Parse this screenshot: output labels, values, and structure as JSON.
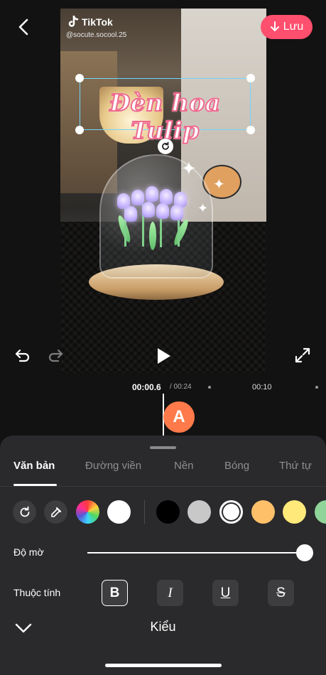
{
  "header": {
    "save_label": "Lưu",
    "accent_color": "#ff4f6e"
  },
  "video": {
    "watermark_brand": "TikTok",
    "watermark_handle": "@socute.socool.25",
    "overlay_text": "Đèn hoa Tulip"
  },
  "timeline": {
    "current_time": "00:00.6",
    "total_time": "/ 00:24",
    "marker_label": "00:10",
    "clip_letter": "A"
  },
  "sheet": {
    "tabs": [
      {
        "label": "Văn bản",
        "active": true
      },
      {
        "label": "Đường viền",
        "active": false
      },
      {
        "label": "Nền",
        "active": false
      },
      {
        "label": "Bóng",
        "active": false
      },
      {
        "label": "Thứ tự",
        "active": false
      }
    ],
    "swatch_colors": [
      "#000000",
      "#c8c8c8",
      "#ffffff",
      "#ffc06a",
      "#ffe97a",
      "#8fd59a"
    ],
    "selected_color": "#ffffff",
    "opacity_label": "Độ mờ",
    "opacity_value": 1.0,
    "attributes_label": "Thuộc tính",
    "attr_bold": "B",
    "attr_italic": "I",
    "attr_underline": "U",
    "attr_strike": "S",
    "footer_title": "Kiểu"
  }
}
